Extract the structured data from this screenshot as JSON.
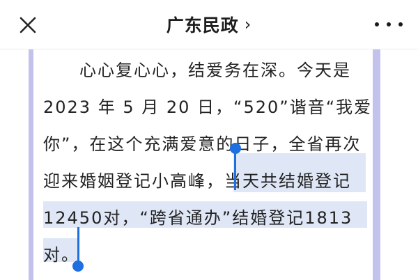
{
  "header": {
    "title": "广东民政",
    "chevron": "›",
    "close_icon": "close-icon",
    "more_icon": "more-icon"
  },
  "article": {
    "lines": [
      "　　心心复心心，结爱务在深。今天是",
      "2023 年 5 月 20 日，“520”谐音“我爱",
      "你”，在这个充满爱意的日子，全省再次",
      "迎来婚姻登记小高峰，当天共结婚登记",
      "12450对，“跨省通办”结婚登记1813",
      "对。"
    ]
  },
  "selection": {
    "selected_text": "当天共结婚登记12450对，“跨省通办”结婚登记1813对。",
    "highlight_color": "#dfe7f6",
    "handle_color": "#1e6fe0"
  }
}
